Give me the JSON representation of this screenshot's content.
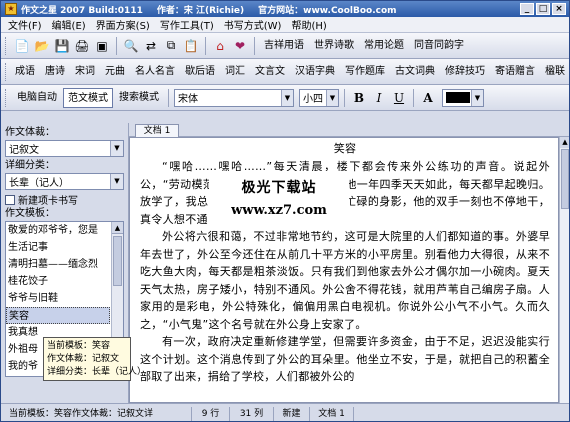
{
  "window": {
    "app_name": "作文之星 2007 Build:0111",
    "author": "作者：宋 江(Richie)",
    "website": "官方网站：www.CoolBoo.com",
    "controls": [
      "_",
      "□",
      "×"
    ]
  },
  "menu": [
    "文件(F)",
    "编辑(E)",
    "界面方案(S)",
    "写作工具(T)",
    "书写方式(W)",
    "帮助(H)"
  ],
  "toolbar1": {
    "icons": [
      "new-file-icon",
      "open-folder-icon",
      "save-icon",
      "print-icon",
      "export-icon",
      "find-icon",
      "replace-icon",
      "copy-icon",
      "paste-icon",
      "home-icon",
      "favorite-icon"
    ],
    "links": [
      "吉祥用语",
      "世界诗歌",
      "常用论题",
      "同音同韵字"
    ]
  },
  "toolbar2": {
    "links": [
      "成语",
      "唐诗",
      "宋词",
      "元曲",
      "名人名言",
      "歇后语",
      "词汇",
      "文言文",
      "汉语字典",
      "写作题库",
      "古文词典",
      "修辞技巧",
      "寄语赠言",
      "楹联"
    ]
  },
  "toolbar3": {
    "modes": [
      "电脑自动",
      "范文模式",
      "搜索模式"
    ],
    "active_mode": "范文模式",
    "font": "宋体",
    "size": "小四",
    "format": [
      "B",
      "I",
      "U"
    ]
  },
  "left_panel": {
    "genre_label": "作文体裁：",
    "genre_value": "记叙文",
    "category_label": "详细分类：",
    "category_value": "长辈（记人）",
    "new_tab_checkbox": "新建项卡书写",
    "template_label": "作文模板：",
    "templates": [
      "敬爱的邓爷爷，您是",
      "生活记事",
      "清明扫墓——缅念烈",
      "桂花饺子",
      "爷爷与旧鞋",
      "笑容",
      "我真想",
      "外祖母",
      "我的爷"
    ],
    "selected_template": "笑容"
  },
  "tooltip": {
    "template": "当前模板：笑容",
    "genre": "作文体裁：记叙文",
    "category": "详细分类：长辈（记人）"
  },
  "editor": {
    "tab": "文档 1",
    "title": "笑容",
    "paragraphs": [
      "“嘿哈……嘿哈……”每天清晨，楼下都会传来外公练功的声音。说起外公，“劳动模范”这一称号再合适不过了，他一年四季天天如此，每天都早起晚归。放学了，我总能远远地看见外公在菜地里忙碌的身影，他的双手一刻也不停地干，真令人想不通，他哪能来这么大的劲儿！",
      "外公将六很和蔼，不过非常地节约，这可是大院里的人们都知道的事。外婆早年去世了，外公至今还住在从前几十平方米的小平房里。别看他力大得很，从来不吃大鱼大肉，每天都是粗茶淡饭。只有我们到他家去外公才偶尔加一小碗肉。夏天天气太热，房子矮小，特别不通风。外公舍不得花钱，就用芦苇自己编房子扇。人家用的是彩电，外公特殊化，偏偏用黑白电视机。你说外公小气不小气。久而久之，“小气鬼”这个名号就在外公身上安家了。",
      "有一次，政府决定重新修建学堂，但需要许多资金，由于不足，迟迟没能实行这个计划。这个消息传到了外公的耳朵里。他坐立不安，于是，就把自己的积蓄全部取了出来，捐给了学校，人们都被外公的"
    ]
  },
  "watermark": {
    "line1": "极光下载站",
    "line2": "www.xz7.com"
  },
  "status": {
    "template": "当前模板：笑容作文体裁：记叙文详",
    "row": "9 行",
    "col": "31 列",
    "state": "新建",
    "doc": "文档 1"
  }
}
